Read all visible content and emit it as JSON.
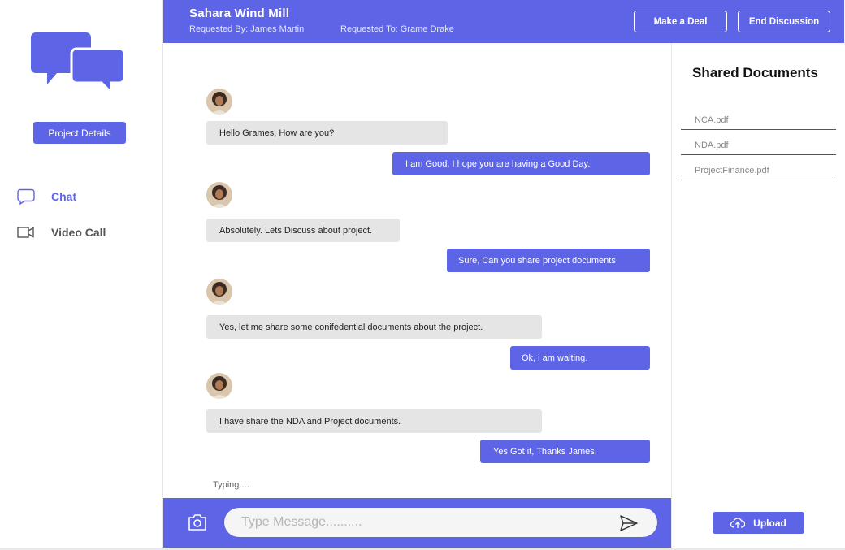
{
  "sidebar": {
    "project_details_label": "Project Details",
    "nav": [
      {
        "label": "Chat",
        "icon": "chat-bubble-icon",
        "active": true
      },
      {
        "label": "Video Call",
        "icon": "video-camera-icon",
        "active": false
      }
    ]
  },
  "header": {
    "title": "Sahara Wind Mill",
    "requested_by": "Requested By: James Martin",
    "requested_to": "Requested To: Grame Drake",
    "make_deal_label": "Make a Deal",
    "end_discussion_label": "End Discussion"
  },
  "messages": [
    {
      "from": "them",
      "text": "Hello Grames, How are you?"
    },
    {
      "from": "me",
      "text": "I am Good, I hope you are having a Good Day."
    },
    {
      "from": "them",
      "text": "Absolutely. Lets Discuss about project."
    },
    {
      "from": "me",
      "text": "Sure, Can you share project documents"
    },
    {
      "from": "them",
      "text": "Yes, let me share some conifedential documents about the project."
    },
    {
      "from": "me",
      "text": "Ok, i am waiting."
    },
    {
      "from": "them",
      "text": "I have share the NDA and Project documents."
    },
    {
      "from": "me",
      "text": "Yes Got it, Thanks James."
    }
  ],
  "typing_text": "Typing....",
  "composer": {
    "placeholder": "Type Message.........."
  },
  "documents": {
    "title": "Shared Documents",
    "files": [
      "NCA.pdf",
      "NDA.pdf",
      "ProjectFinance.pdf"
    ],
    "upload_label": "Upload"
  },
  "colors": {
    "accent": "#5d65e6",
    "incoming_bubble": "#e5e5e5"
  }
}
